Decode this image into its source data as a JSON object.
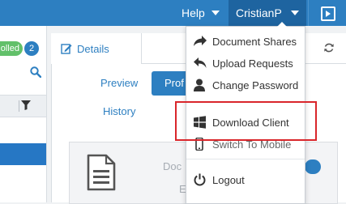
{
  "topbar": {
    "help_label": "Help",
    "user_label": "CristianP"
  },
  "left_panel": {
    "status_badge": "olled",
    "count_badge": "2"
  },
  "main": {
    "tab_details": "Details",
    "link_preview": "Preview",
    "btn_profile": "Prof",
    "link_history": "History",
    "doc_text_1": "Doc",
    "doc_text_2": "E"
  },
  "dropdown": {
    "items": [
      {
        "label": "Document Shares",
        "icon": "share-icon"
      },
      {
        "label": "Upload Requests",
        "icon": "reply-icon"
      },
      {
        "label": "Change Password",
        "icon": "user-icon"
      },
      {
        "label": "Download Client",
        "icon": "windows-icon"
      },
      {
        "label": "Switch To Mobile",
        "icon": "mobile-icon"
      },
      {
        "label": "Logout",
        "icon": "power-icon"
      }
    ]
  },
  "colors": {
    "topbar": "#2d7fc1",
    "user_active": "#1e64a0",
    "link": "#2d7fc1",
    "highlight": "#d9262b",
    "badge_green": "#62c06a"
  }
}
